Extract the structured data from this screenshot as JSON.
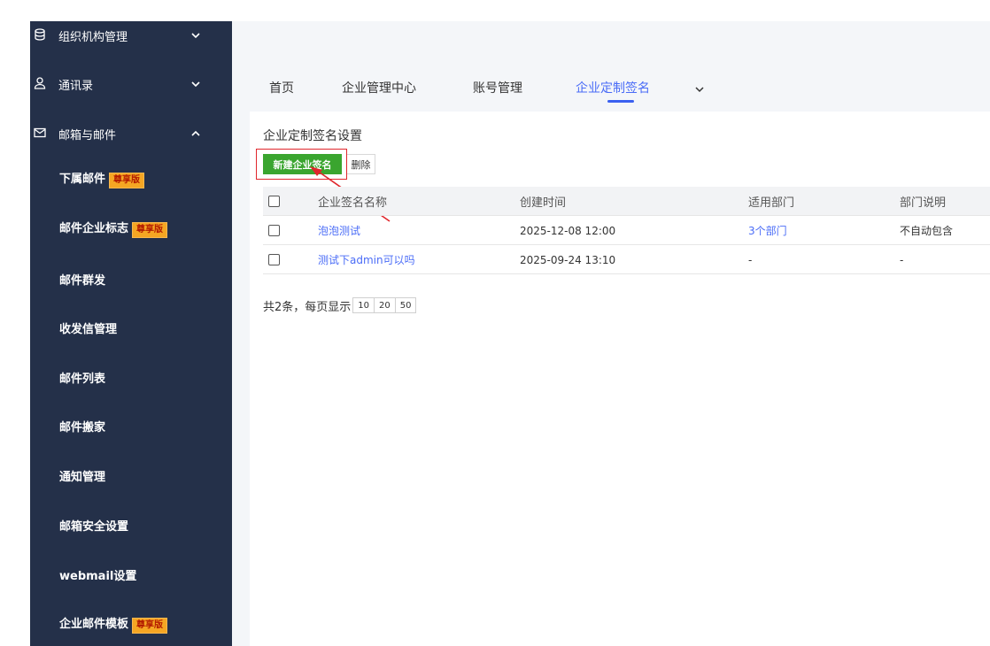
{
  "sidebar": {
    "groups": [
      {
        "label": "组织机构管理",
        "icon": "database-icon",
        "expanded": false
      },
      {
        "label": "通讯录",
        "icon": "user-icon",
        "expanded": false
      },
      {
        "label": "邮箱与邮件",
        "icon": "mail-icon",
        "expanded": true
      }
    ],
    "items": [
      {
        "label": "下属邮件",
        "badge": "尊享版"
      },
      {
        "label": "邮件企业标志",
        "badge": "尊享版"
      },
      {
        "label": "邮件群发",
        "badge": ""
      },
      {
        "label": "收发信管理",
        "badge": ""
      },
      {
        "label": "邮件列表",
        "badge": ""
      },
      {
        "label": "邮件搬家",
        "badge": ""
      },
      {
        "label": "通知管理",
        "badge": ""
      },
      {
        "label": "邮箱安全设置",
        "badge": ""
      },
      {
        "label": "webmail设置",
        "badge": ""
      },
      {
        "label": "企业邮件模板",
        "badge": "尊享版"
      }
    ]
  },
  "tabs": [
    {
      "label": "首页",
      "active": false
    },
    {
      "label": "企业管理中心",
      "active": false
    },
    {
      "label": "账号管理",
      "active": false
    },
    {
      "label": "企业定制签名",
      "active": true
    }
  ],
  "panel": {
    "title": "企业定制签名设置",
    "new_button": "新建企业签名",
    "delete_button": "删除"
  },
  "table": {
    "columns": [
      "企业签名名称",
      "创建时间",
      "适用部门",
      "部门说明"
    ],
    "rows": [
      {
        "name": "泡泡测试",
        "created": "2025-12-08 12:00",
        "departments": "3个部门",
        "note": "不自动包含"
      },
      {
        "name": "测试下admin可以吗",
        "created": "2025-09-24 13:10",
        "departments": "-",
        "note": "-"
      }
    ]
  },
  "pager": {
    "summary": "共2条，每页显示",
    "sizes": [
      "10",
      "20",
      "50"
    ]
  },
  "colors": {
    "sidebar_bg": "#243049",
    "accent": "#4a6cf7",
    "primary_button": "#3aa52f",
    "badge": "#f5a623",
    "highlight": "#e0262c"
  }
}
